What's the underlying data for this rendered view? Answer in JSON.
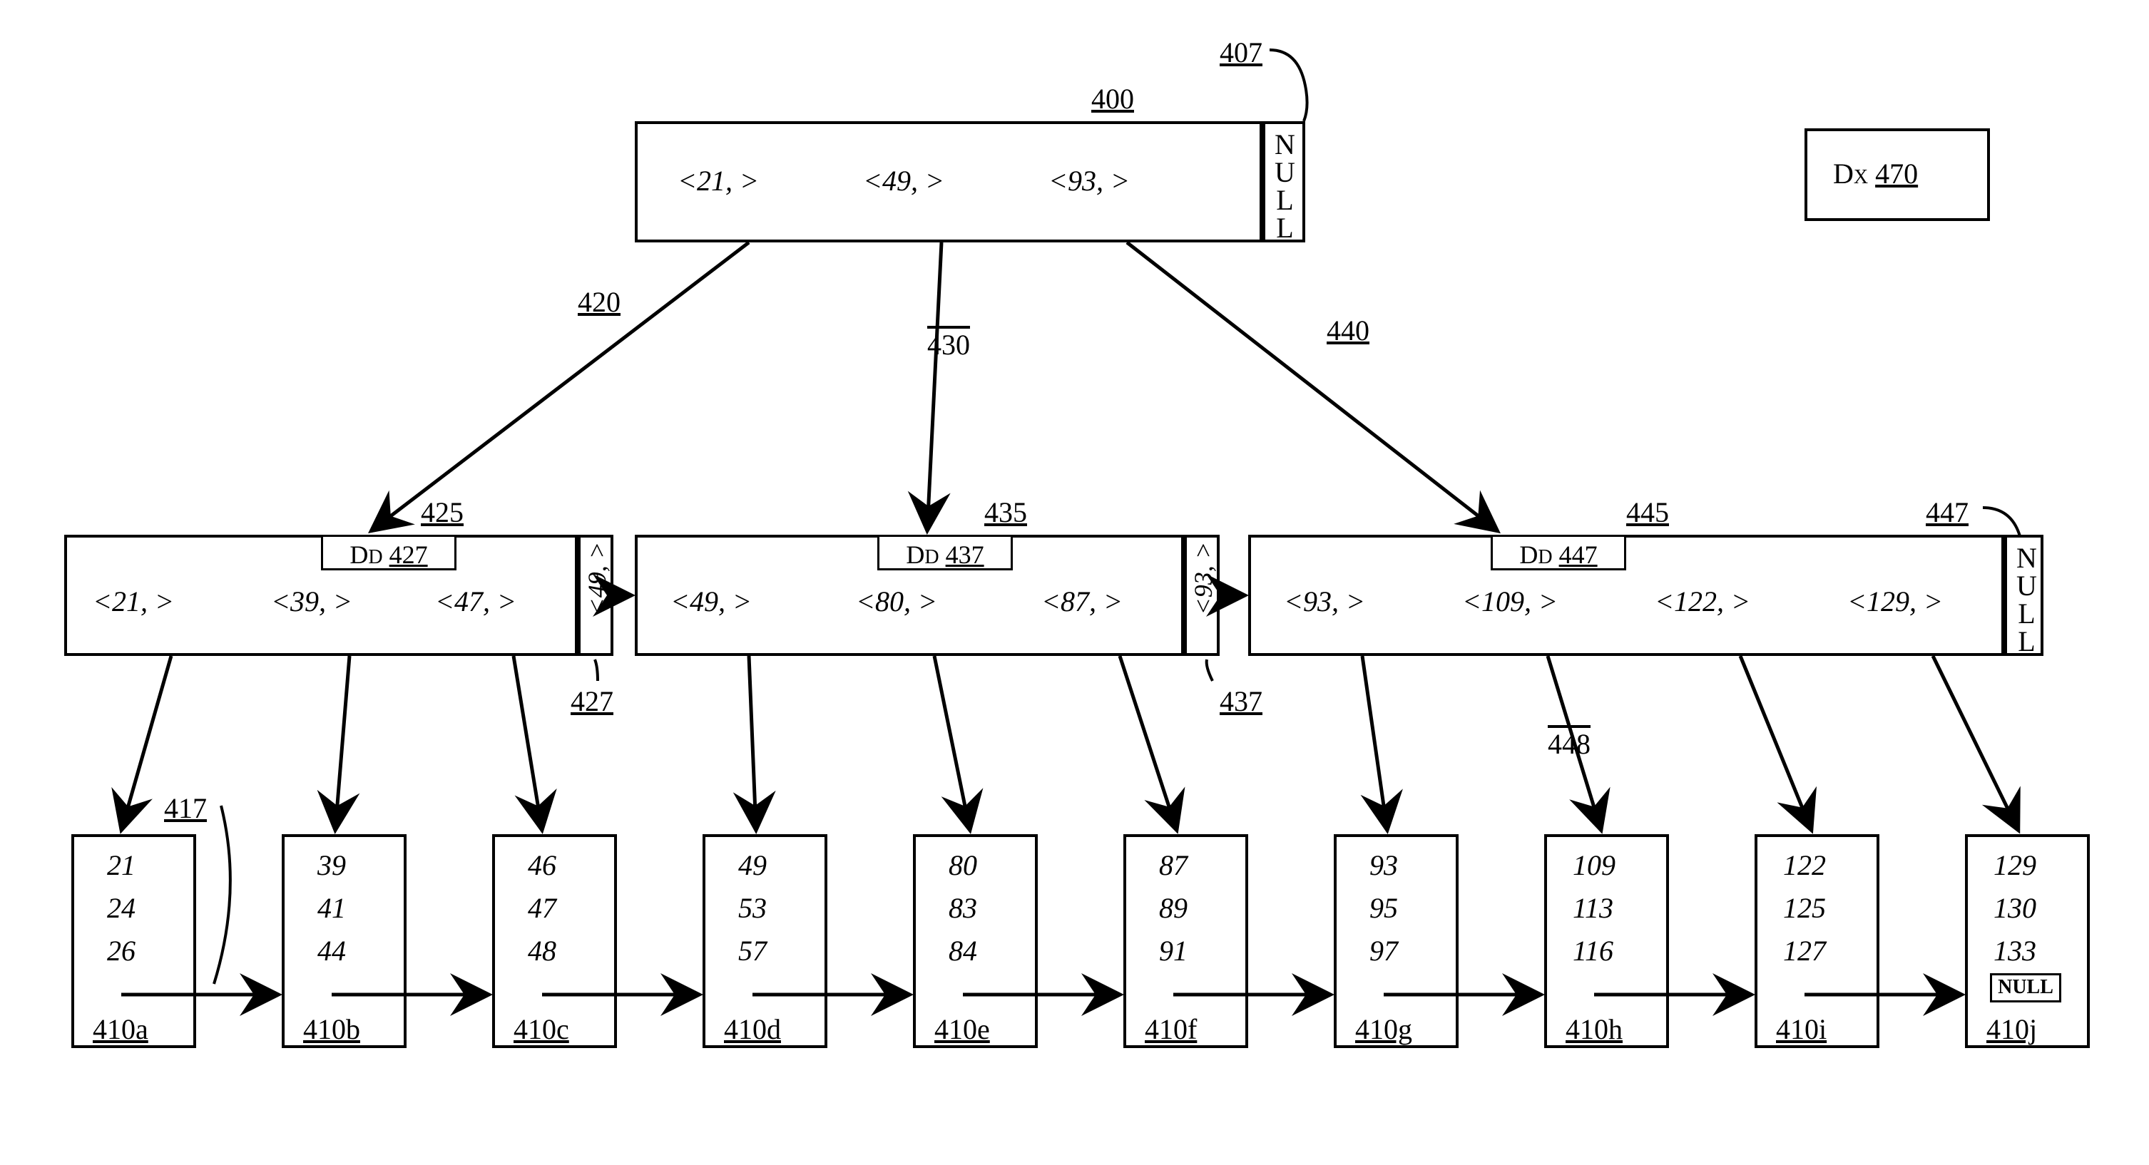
{
  "legend": {
    "dx": "Dₓ 470"
  },
  "root": {
    "ref": "400",
    "null_ref": "407",
    "null_text": "NULL",
    "keys": [
      "<21,   >",
      "<49,   >",
      "<93,   >"
    ]
  },
  "edges_top": {
    "e420": "420",
    "e430": "430",
    "e440": "440"
  },
  "mid": {
    "n425": {
      "ref": "425",
      "dd": "D_D 427",
      "keys": [
        "<21,   >",
        "<39,   >",
        "<47,   >"
      ],
      "sidekey": "<49,   >",
      "side_ref": "427"
    },
    "n435": {
      "ref": "435",
      "dd": "D_D 437",
      "keys": [
        "<49,   >",
        "<80,   >",
        "<87,   >"
      ],
      "sidekey": "<93,   >",
      "side_ref": "437"
    },
    "n445": {
      "ref": "445",
      "dd": "D_D 447",
      "keys": [
        "<93,   >",
        "<109,   >",
        "<122,   >",
        "<129,   >"
      ],
      "null_text": "NULL",
      "null_ref": "447"
    }
  },
  "edge_mid": {
    "e448": "448"
  },
  "leaf_link_ref": "417",
  "leaves": {
    "a": {
      "ref": "410a",
      "vals": [
        "21",
        "24",
        "26"
      ]
    },
    "b": {
      "ref": "410b",
      "vals": [
        "39",
        "41",
        "44"
      ]
    },
    "c": {
      "ref": "410c",
      "vals": [
        "46",
        "47",
        "48"
      ]
    },
    "d": {
      "ref": "410d",
      "vals": [
        "49",
        "53",
        "57"
      ]
    },
    "e": {
      "ref": "410e",
      "vals": [
        "80",
        "83",
        "84"
      ]
    },
    "f": {
      "ref": "410f",
      "vals": [
        "87",
        "89",
        "91"
      ]
    },
    "g": {
      "ref": "410g",
      "vals": [
        "93",
        "95",
        "97"
      ]
    },
    "h": {
      "ref": "410h",
      "vals": [
        "109",
        "113",
        "116"
      ]
    },
    "i": {
      "ref": "410i",
      "vals": [
        "122",
        "125",
        "127"
      ]
    },
    "j": {
      "ref": "410j",
      "vals": [
        "129",
        "130",
        "133"
      ],
      "null": "NULL"
    }
  }
}
